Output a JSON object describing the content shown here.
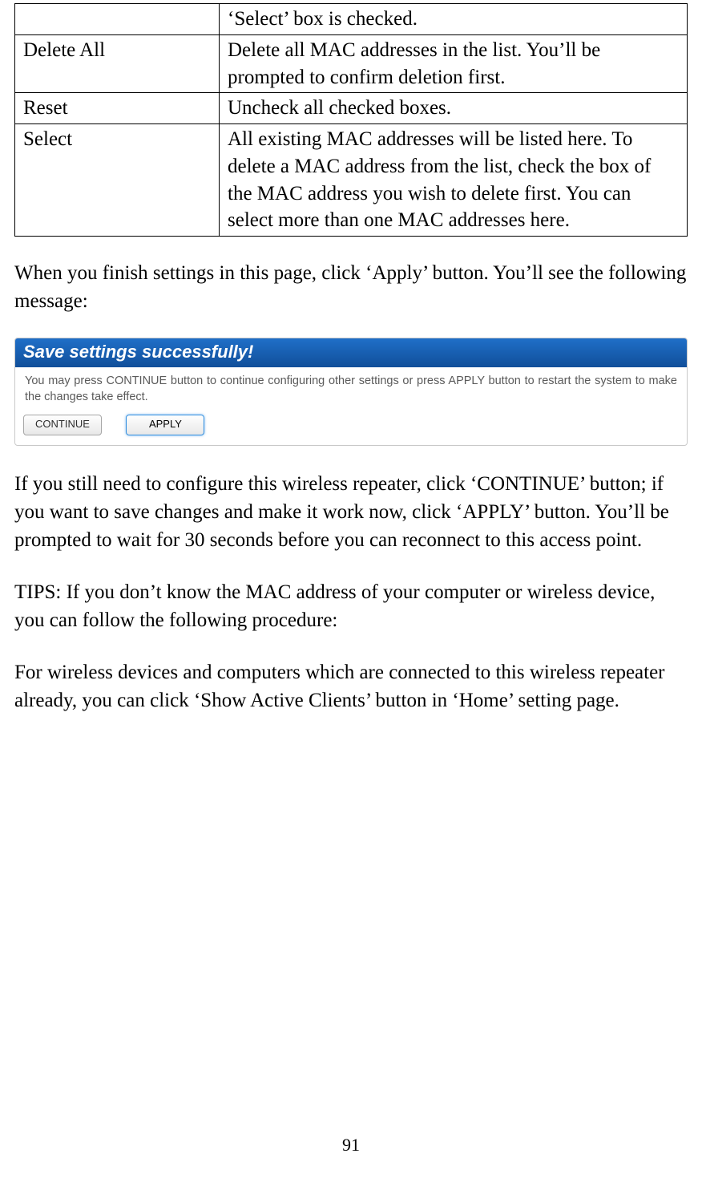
{
  "table": {
    "rows": [
      {
        "term": "",
        "desc": "‘Select’ box is checked."
      },
      {
        "term": "Delete All",
        "desc": "Delete all MAC addresses in the list. You’ll be prompted to confirm deletion first."
      },
      {
        "term": "Reset",
        "desc": "Uncheck all checked boxes."
      },
      {
        "term": "Select",
        "desc": "All existing MAC addresses will be listed here. To delete a MAC address from the list, check the box of the MAC address you wish to delete first. You can select more than one MAC addresses here."
      }
    ]
  },
  "paragraphs": {
    "p1": "When you finish settings in this page, click ‘Apply’ button. You’ll see the following message:",
    "p2": "If you still need to configure this wireless repeater, click ‘CONTINUE’ button; if you want to save changes and make it work now, click ‘APPLY’ button. You’ll be prompted to wait for 30 seconds before you can reconnect to this access point.",
    "p3": "TIPS: If you don’t know the MAC address of your computer or wireless device, you can follow the following procedure:",
    "p4": "For wireless devices and computers which are connected to this wireless repeater already, you can click ‘Show Active Clients’ button in ‘Home’ setting page."
  },
  "save_dialog": {
    "title": "Save settings successfully!",
    "body": "You may press CONTINUE button to continue configuring other settings or press APPLY button to restart the system to make the changes take effect.",
    "continue_label": "CONTINUE",
    "apply_label": "APPLY"
  },
  "page_number": "91"
}
